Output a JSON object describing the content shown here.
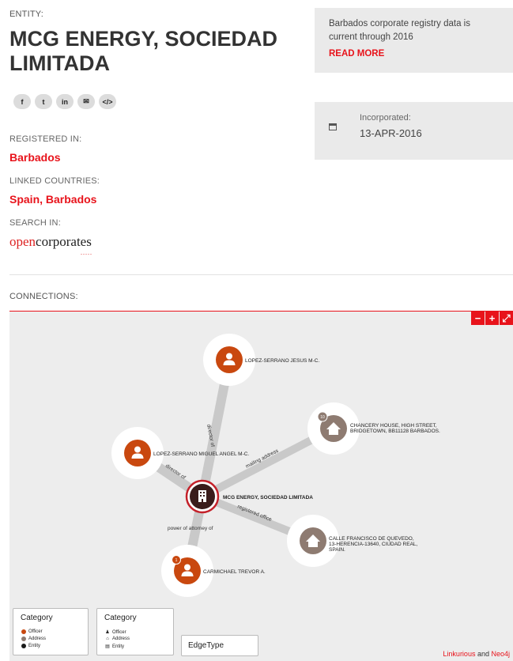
{
  "entity": {
    "label": "ENTITY:",
    "name": "MCG ENERGY, SOCIEDAD LIMITADA"
  },
  "socials": [
    {
      "icon": "facebook-icon",
      "glyph": "f"
    },
    {
      "icon": "twitter-icon",
      "glyph": "t"
    },
    {
      "icon": "linkedin-icon",
      "glyph": "in"
    },
    {
      "icon": "email-icon",
      "glyph": "✉"
    },
    {
      "icon": "embed-icon",
      "glyph": "</>"
    }
  ],
  "fields": {
    "registered_label": "REGISTERED IN:",
    "registered_value": "Barbados",
    "linked_label": "LINKED COUNTRIES:",
    "linked_value": "Spain, Barbados",
    "search_label": "SEARCH IN:",
    "opencorporates_open": "open",
    "opencorporates_rest": "corporates",
    "opencorporates_dots": "....."
  },
  "notice": {
    "text": "Barbados corporate registry data is current through 2016",
    "read_more": "READ MORE"
  },
  "incorporated": {
    "icon": "calendar-icon",
    "label": "Incorporated:",
    "value": "13-APR-2016"
  },
  "connections": {
    "label": "CONNECTIONS:",
    "zoom_out": "−",
    "zoom_in": "+",
    "fullscreen": "⤢"
  },
  "graph": {
    "center_label": "MCG ENERGY, SOCIEDAD LIMITADA",
    "officer1_label": "LOPEZ-SERRANO JESUS M-C.",
    "officer2_label": "LOPEZ-SERRANO MIGUEL ANGEL M-C.",
    "officer3_label": "CARMICHAEL TREVOR A.",
    "address1_line1": "CHANCERY HOUSE, HIGH STREET,",
    "address1_line2": "BRIDGETOWN, BB11128 BARBADOS.",
    "address2_line1": "CALLE FRANCISCO DE QUEVEDO,",
    "address2_line2": "13-HERENCIA-13640, CIUDAD REAL,",
    "address2_line3": "SPAIN.",
    "address1_badge": "10",
    "officer3_badge": "1",
    "edge_director1": "director of",
    "edge_director2": "director of",
    "edge_mailing": "mailing address",
    "edge_registered": "registered office",
    "edge_power": "power of attorney of",
    "colors": {
      "officer": "#c9480f",
      "address": "#8e7b71",
      "entity": "#3a1c1b",
      "accent": "#e8131b"
    }
  },
  "legend1": {
    "title": "Category",
    "items": [
      "Officer",
      "Address",
      "Entity"
    ]
  },
  "legend2": {
    "title": "Category",
    "items": [
      "Officer",
      "Address",
      "Entity"
    ]
  },
  "edgetype": {
    "title": "EdgeType"
  },
  "credit": {
    "linkurious": "Linkurious",
    "and": " and ",
    "neo4j": "Neo4j"
  }
}
